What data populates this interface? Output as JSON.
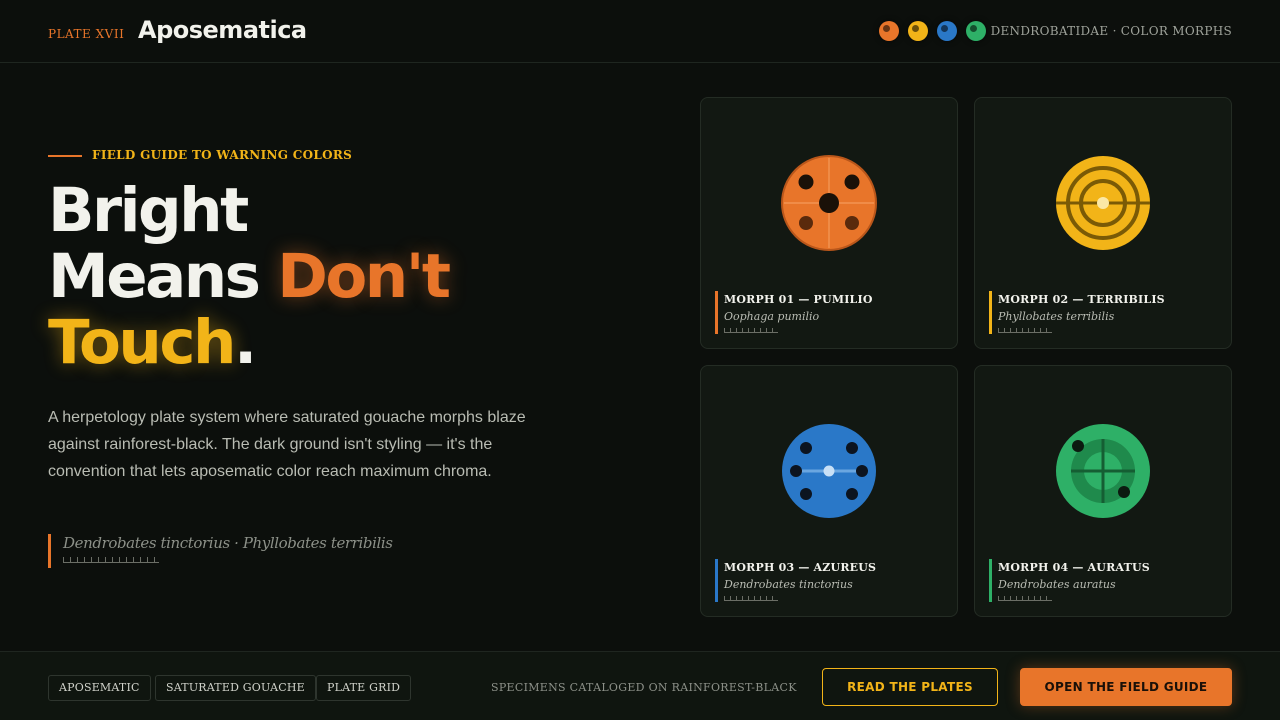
{
  "header": {
    "plate_label": "PLATE XVII",
    "brand": "Aposematica",
    "swatches": [
      {
        "name": "orange",
        "color": "#e8752a"
      },
      {
        "name": "yellow",
        "color": "#f2b418"
      },
      {
        "name": "blue",
        "color": "#2a78c8"
      },
      {
        "name": "green",
        "color": "#2eb067"
      }
    ],
    "family_label": "DENDROBATIDAE · COLOR MORPHS"
  },
  "hero": {
    "kicker": "FIELD GUIDE TO WARNING COLORS",
    "headline": {
      "line1": "Bright",
      "line2_a": "Means",
      "line2_b": "Don't",
      "line3_a": "Touch",
      "line3_b": "."
    },
    "lede": "A herpetology plate system where saturated gouache morphs blaze against rainforest-black. The dark ground isn't styling — it's the convention that lets aposematic color reach maximum chroma.",
    "quote": "Dendrobates tinctorius · Phyllobates terribilis"
  },
  "cards": [
    {
      "title": "MORPH 01 — PUMILIO",
      "species": "Oophaga pumilio",
      "color": "#e8752a",
      "pattern": "spots-cross"
    },
    {
      "title": "MORPH 02 — TERRIBILIS",
      "species": "Phyllobates terribilis",
      "color": "#f2b418",
      "pattern": "target-rings"
    },
    {
      "title": "MORPH 03 — AZUREUS",
      "species": "Dendrobates tinctorius",
      "color": "#2a78c8",
      "pattern": "six-spots"
    },
    {
      "title": "MORPH 04 — AURATUS",
      "species": "Dendrobates auratus",
      "color": "#2eb067",
      "pattern": "crosshair-rings"
    }
  ],
  "footer": {
    "tags": [
      "APOSEMATIC",
      "SATURATED GOUACHE",
      "PLATE GRID"
    ],
    "note": "SPECIMENS CATALOGED ON RAINFOREST-BLACK",
    "secondary_button": "READ THE PLATES",
    "primary_button": "OPEN THE FIELD GUIDE"
  }
}
